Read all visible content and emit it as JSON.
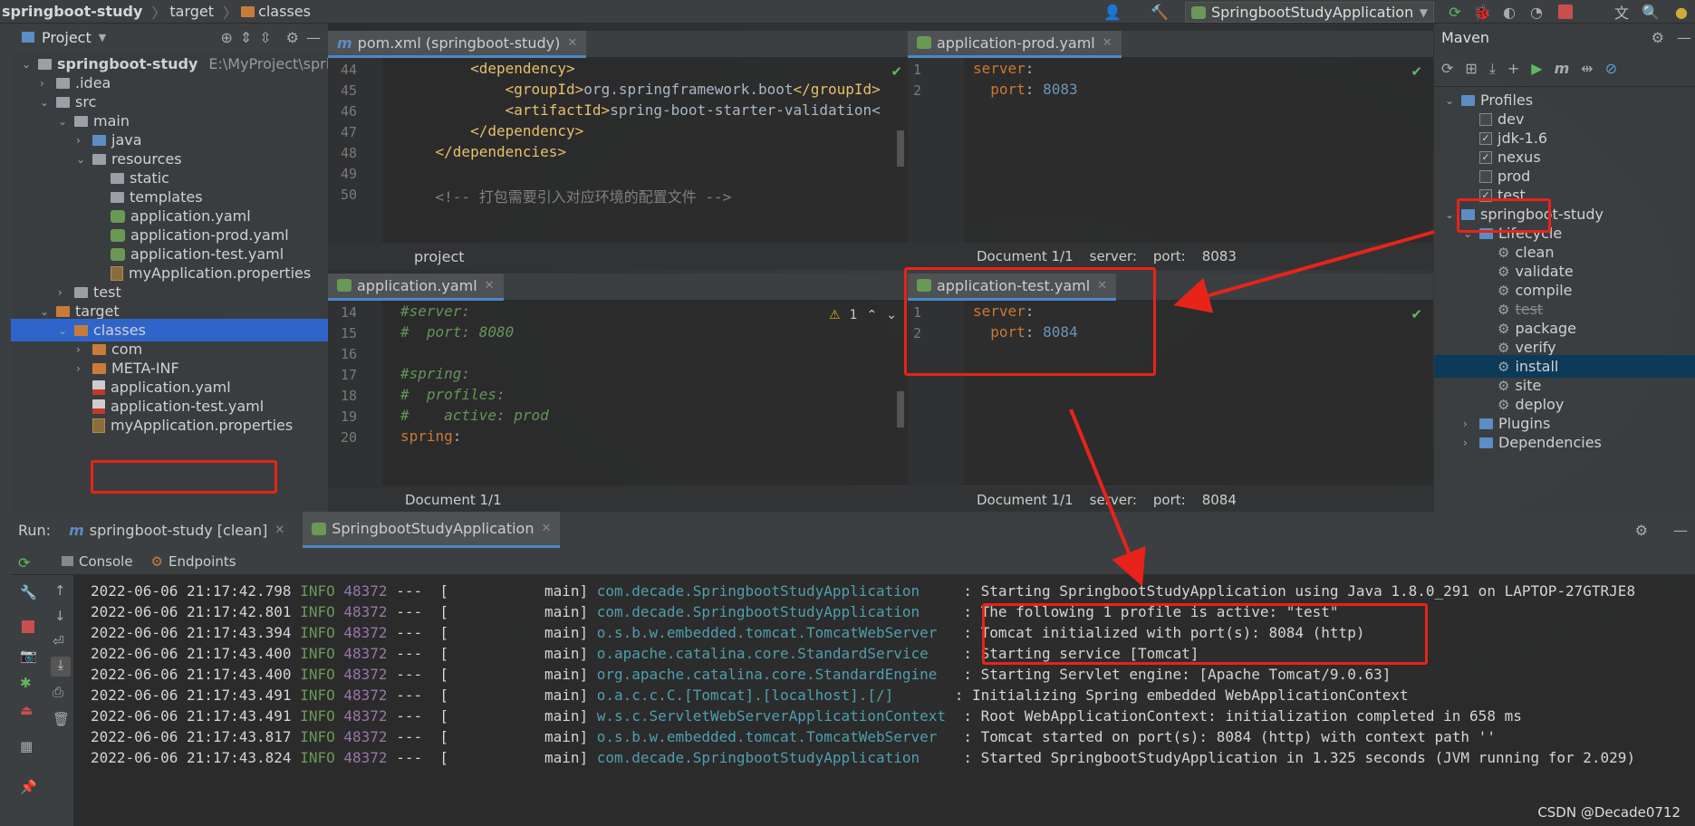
{
  "navbar": {
    "project": "springboot-study",
    "crumb1": "target",
    "crumb2": "classes",
    "run_config": "SpringbootStudyApplication"
  },
  "project_panel": {
    "title": "Project",
    "tree": [
      {
        "label": "springboot-study",
        "extra": "E:\\MyProject\\springb",
        "bold": true,
        "icon": "module",
        "indent": 0,
        "arrow": "down"
      },
      {
        "label": ".idea",
        "icon": "folder-grey",
        "indent": 1,
        "arrow": "right"
      },
      {
        "label": "src",
        "icon": "folder-grey",
        "indent": 1,
        "arrow": "down"
      },
      {
        "label": "main",
        "icon": "folder-grey",
        "indent": 2,
        "arrow": "down"
      },
      {
        "label": "java",
        "icon": "folder-blue",
        "indent": 3,
        "arrow": "right"
      },
      {
        "label": "resources",
        "icon": "folder-grey",
        "indent": 3,
        "arrow": "down"
      },
      {
        "label": "static",
        "icon": "folder-grey",
        "indent": 4,
        "arrow": ""
      },
      {
        "label": "templates",
        "icon": "folder-grey",
        "indent": 4,
        "arrow": ""
      },
      {
        "label": "application.yaml",
        "icon": "yaml",
        "indent": 4,
        "arrow": ""
      },
      {
        "label": "application-prod.yaml",
        "icon": "yaml",
        "indent": 4,
        "arrow": ""
      },
      {
        "label": "application-test.yaml",
        "icon": "yaml",
        "indent": 4,
        "arrow": ""
      },
      {
        "label": "myApplication.properties",
        "icon": "props",
        "indent": 4,
        "arrow": ""
      },
      {
        "label": "test",
        "icon": "folder-grey",
        "indent": 2,
        "arrow": "right"
      },
      {
        "label": "target",
        "icon": "folder-orange",
        "indent": 1,
        "arrow": "down"
      },
      {
        "label": "classes",
        "icon": "folder-orange",
        "indent": 2,
        "arrow": "down",
        "selected": true
      },
      {
        "label": "com",
        "icon": "folder-orange",
        "indent": 3,
        "arrow": "right"
      },
      {
        "label": "META-INF",
        "icon": "folder-orange",
        "indent": 3,
        "arrow": "right"
      },
      {
        "label": "application.yaml",
        "icon": "yml-file",
        "indent": 3,
        "arrow": ""
      },
      {
        "label": "application-test.yaml",
        "icon": "yml-file",
        "indent": 3,
        "arrow": ""
      },
      {
        "label": "myApplication.properties",
        "icon": "props",
        "indent": 3,
        "arrow": ""
      }
    ]
  },
  "editors": {
    "pom": {
      "tab": "pom.xml (springboot-study)",
      "breadcrumb": "project",
      "lines": [
        {
          "n": "44",
          "parts": [
            {
              "t": "        ",
              "c": "txt"
            },
            {
              "t": "<dependency>",
              "c": "tag"
            }
          ]
        },
        {
          "n": "45",
          "parts": [
            {
              "t": "            ",
              "c": "txt"
            },
            {
              "t": "<groupId>",
              "c": "tag"
            },
            {
              "t": "org.springframework.boot",
              "c": "txt"
            },
            {
              "t": "</groupId>",
              "c": "tag"
            }
          ]
        },
        {
          "n": "46",
          "parts": [
            {
              "t": "            ",
              "c": "txt"
            },
            {
              "t": "<artifactId>",
              "c": "tag"
            },
            {
              "t": "spring-boot-starter-validation<",
              "c": "txt"
            }
          ]
        },
        {
          "n": "47",
          "parts": [
            {
              "t": "        ",
              "c": "txt"
            },
            {
              "t": "</dependency>",
              "c": "tag"
            }
          ]
        },
        {
          "n": "48",
          "parts": [
            {
              "t": "    ",
              "c": "txt"
            },
            {
              "t": "</dependencies>",
              "c": "tag"
            }
          ]
        },
        {
          "n": "49",
          "parts": [
            {
              "t": "",
              "c": "txt"
            }
          ]
        },
        {
          "n": "50",
          "parts": [
            {
              "t": "    ",
              "c": "txt"
            },
            {
              "t": "<!-- 打包需要引入对应环境的配置文件 -->",
              "c": "cmt"
            }
          ]
        }
      ]
    },
    "prod": {
      "tab": "application-prod.yaml",
      "status": [
        "Document 1/1",
        "server:",
        "port:",
        "8083"
      ],
      "lines": [
        {
          "n": "1",
          "parts": [
            {
              "t": "server",
              "c": "key"
            },
            {
              "t": ":",
              "c": "txt"
            }
          ]
        },
        {
          "n": "2",
          "parts": [
            {
              "t": "  port",
              "c": "key"
            },
            {
              "t": ": ",
              "c": "txt"
            },
            {
              "t": "8083",
              "c": "num"
            }
          ]
        }
      ]
    },
    "app": {
      "tab": "application.yaml",
      "status": "Document 1/1",
      "warning_count": "1",
      "lines": [
        {
          "n": "14",
          "parts": [
            {
              "t": "#server:",
              "c": "cmti"
            }
          ]
        },
        {
          "n": "15",
          "parts": [
            {
              "t": "#  port: 8080",
              "c": "cmti"
            }
          ]
        },
        {
          "n": "16",
          "parts": [
            {
              "t": "",
              "c": "txt"
            }
          ]
        },
        {
          "n": "17",
          "parts": [
            {
              "t": "#spring:",
              "c": "cmti"
            }
          ]
        },
        {
          "n": "18",
          "parts": [
            {
              "t": "#  profiles:",
              "c": "cmti"
            }
          ]
        },
        {
          "n": "19",
          "parts": [
            {
              "t": "#    active: prod",
              "c": "cmti"
            }
          ]
        },
        {
          "n": "20",
          "parts": [
            {
              "t": "spring",
              "c": "key"
            },
            {
              "t": ":",
              "c": "txt"
            }
          ]
        }
      ]
    },
    "test": {
      "tab": "application-test.yaml",
      "status": [
        "Document 1/1",
        "server:",
        "port:",
        "8084"
      ],
      "lines": [
        {
          "n": "1",
          "parts": [
            {
              "t": "server",
              "c": "key"
            },
            {
              "t": ":",
              "c": "txt"
            }
          ]
        },
        {
          "n": "2",
          "parts": [
            {
              "t": "  port",
              "c": "key"
            },
            {
              "t": ": ",
              "c": "txt"
            },
            {
              "t": "8084",
              "c": "num"
            }
          ]
        }
      ]
    }
  },
  "maven": {
    "title": "Maven",
    "items": [
      {
        "label": "Profiles",
        "indent": 0,
        "arrow": "down",
        "kind": "folder"
      },
      {
        "label": "dev",
        "indent": 1,
        "kind": "check",
        "checked": false
      },
      {
        "label": "jdk-1.6",
        "indent": 1,
        "kind": "check",
        "checked": true
      },
      {
        "label": "nexus",
        "indent": 1,
        "kind": "check",
        "checked": true
      },
      {
        "label": "prod",
        "indent": 1,
        "kind": "check",
        "checked": false
      },
      {
        "label": "test",
        "indent": 1,
        "kind": "check",
        "checked": true
      },
      {
        "label": "springboot-study",
        "indent": 0,
        "arrow": "down",
        "kind": "module"
      },
      {
        "label": "Lifecycle",
        "indent": 1,
        "arrow": "down",
        "kind": "folder"
      },
      {
        "label": "clean",
        "indent": 2,
        "kind": "goal"
      },
      {
        "label": "validate",
        "indent": 2,
        "kind": "goal"
      },
      {
        "label": "compile",
        "indent": 2,
        "kind": "goal"
      },
      {
        "label": "test",
        "indent": 2,
        "kind": "goal",
        "struck": true
      },
      {
        "label": "package",
        "indent": 2,
        "kind": "goal"
      },
      {
        "label": "verify",
        "indent": 2,
        "kind": "goal"
      },
      {
        "label": "install",
        "indent": 2,
        "kind": "goal",
        "selected": true
      },
      {
        "label": "site",
        "indent": 2,
        "kind": "goal"
      },
      {
        "label": "deploy",
        "indent": 2,
        "kind": "goal"
      },
      {
        "label": "Plugins",
        "indent": 1,
        "arrow": "right",
        "kind": "folder"
      },
      {
        "label": "Dependencies",
        "indent": 1,
        "arrow": "right",
        "kind": "folder"
      }
    ]
  },
  "run": {
    "label": "Run:",
    "tab1": "springboot-study [clean]",
    "tab2": "SpringbootStudyApplication",
    "console_tab": "Console",
    "endpoints_tab": "Endpoints",
    "logs": [
      {
        "ts": "2022-06-06 21:17:42.798",
        "lvl": "INFO",
        "pid": "48372",
        "thread": "---  [           main]",
        "cls": "com.decade.SpringbootStudyApplication    ",
        "msg": ": Starting SpringbootStudyApplication using Java 1.8.0_291 on LAPTOP-27GTRJE8"
      },
      {
        "ts": "2022-06-06 21:17:42.801",
        "lvl": "INFO",
        "pid": "48372",
        "thread": "---  [           main]",
        "cls": "com.decade.SpringbootStudyApplication    ",
        "msg": ": The following 1 profile is active: \"test\""
      },
      {
        "ts": "2022-06-06 21:17:43.394",
        "lvl": "INFO",
        "pid": "48372",
        "thread": "---  [           main]",
        "cls": "o.s.b.w.embedded.tomcat.TomcatWebServer  ",
        "msg": ": Tomcat initialized with port(s): 8084 (http)"
      },
      {
        "ts": "2022-06-06 21:17:43.400",
        "lvl": "INFO",
        "pid": "48372",
        "thread": "---  [           main]",
        "cls": "o.apache.catalina.core.StandardService   ",
        "msg": ": Starting service [Tomcat]"
      },
      {
        "ts": "2022-06-06 21:17:43.400",
        "lvl": "INFO",
        "pid": "48372",
        "thread": "---  [           main]",
        "cls": "org.apache.catalina.core.StandardEngine  ",
        "msg": ": Starting Servlet engine: [Apache Tomcat/9.0.63]"
      },
      {
        "ts": "2022-06-06 21:17:43.491",
        "lvl": "INFO",
        "pid": "48372",
        "thread": "---  [           main]",
        "cls": "o.a.c.c.C.[Tomcat].[localhost].[/]      ",
        "msg": ": Initializing Spring embedded WebApplicationContext"
      },
      {
        "ts": "2022-06-06 21:17:43.491",
        "lvl": "INFO",
        "pid": "48372",
        "thread": "---  [           main]",
        "cls": "w.s.c.ServletWebServerApplicationContext ",
        "msg": ": Root WebApplicationContext: initialization completed in 658 ms"
      },
      {
        "ts": "2022-06-06 21:17:43.817",
        "lvl": "INFO",
        "pid": "48372",
        "thread": "---  [           main]",
        "cls": "o.s.b.w.embedded.tomcat.TomcatWebServer  ",
        "msg": ": Tomcat started on port(s): 8084 (http) with context path ''"
      },
      {
        "ts": "2022-06-06 21:17:43.824",
        "lvl": "INFO",
        "pid": "48372",
        "thread": "---  [           main]",
        "cls": "com.decade.SpringbootStudyApplication    ",
        "msg": ": Started SpringbootStudyApplication in 1.325 seconds (JVM running for 2.029)"
      }
    ]
  },
  "watermark": "CSDN @Decade0712",
  "colors": {
    "highlight": "#e8231a",
    "selection": "#2f65ca",
    "accent": "#4a88c7"
  }
}
